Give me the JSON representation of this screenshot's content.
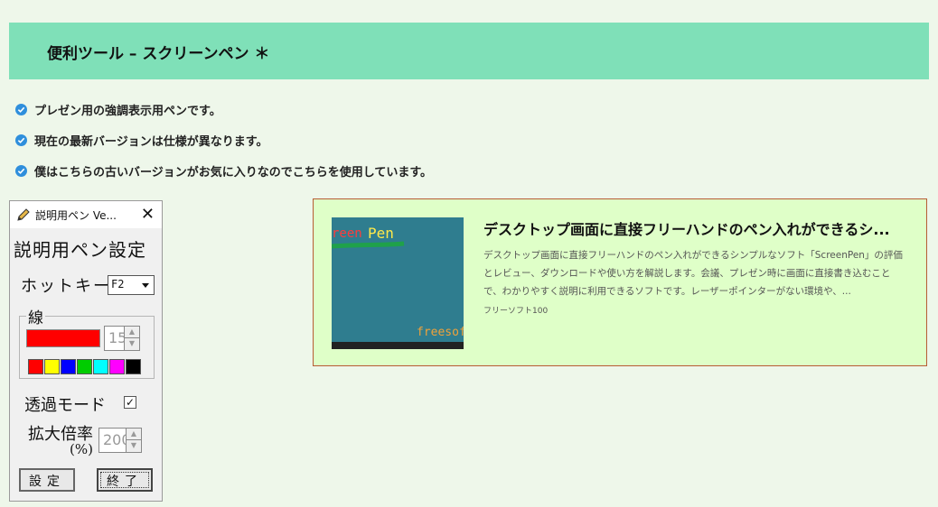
{
  "header": {
    "title": "便利ツール – スクリーンペン ＊"
  },
  "bullets": [
    "プレゼン用の強調表示用ペンです。",
    "現在の最新バージョンは仕様が異なります。",
    "僕はこちらの古いバージョンがお気に入りなのでこちらを使用しています。"
  ],
  "dialog": {
    "title": "説明用ペン Ve...",
    "close": "✕",
    "heading": "説明用ペン設定",
    "hotkey_label": "ホットキー",
    "hotkey_value": "F2",
    "line_group": "線",
    "line_width": "15",
    "swatches": [
      "#ff0000",
      "#ffff00",
      "#0000ff",
      "#00cc00",
      "#00ffff",
      "#ff00ff",
      "#000000"
    ],
    "transparent_label": "透過モード",
    "transparent_checked": "✓",
    "zoom_label": "拡大倍率",
    "zoom_unit": "(%)",
    "zoom_value": "200",
    "set_button": "設定",
    "exit_button": "終了"
  },
  "card": {
    "title": "デスクトップ画面に直接フリーハンドのペン入れができるシ...",
    "description": "デスクトップ画面に直接フリーハンドのペン入れができるシンプルなソフト「ScreenPen」の評価とレビュー、ダウンロードや使い方を解説します。会議、プレゼン時に画面に直接書き込むことで、わかりやすく説明に利用できるソフトです。レーザーポインターがない環境や、...",
    "site": "フリーソフト100",
    "thumb_text_left": "reen",
    "thumb_text_right": "Pen",
    "thumb_text_corner": "freesof"
  },
  "colors": {
    "header_bg": "#7fe0b8",
    "page_bg": "#eef7ea",
    "check": "#2f8fdc",
    "card_bg": "#dfffc8",
    "card_border": "#b85c35"
  }
}
